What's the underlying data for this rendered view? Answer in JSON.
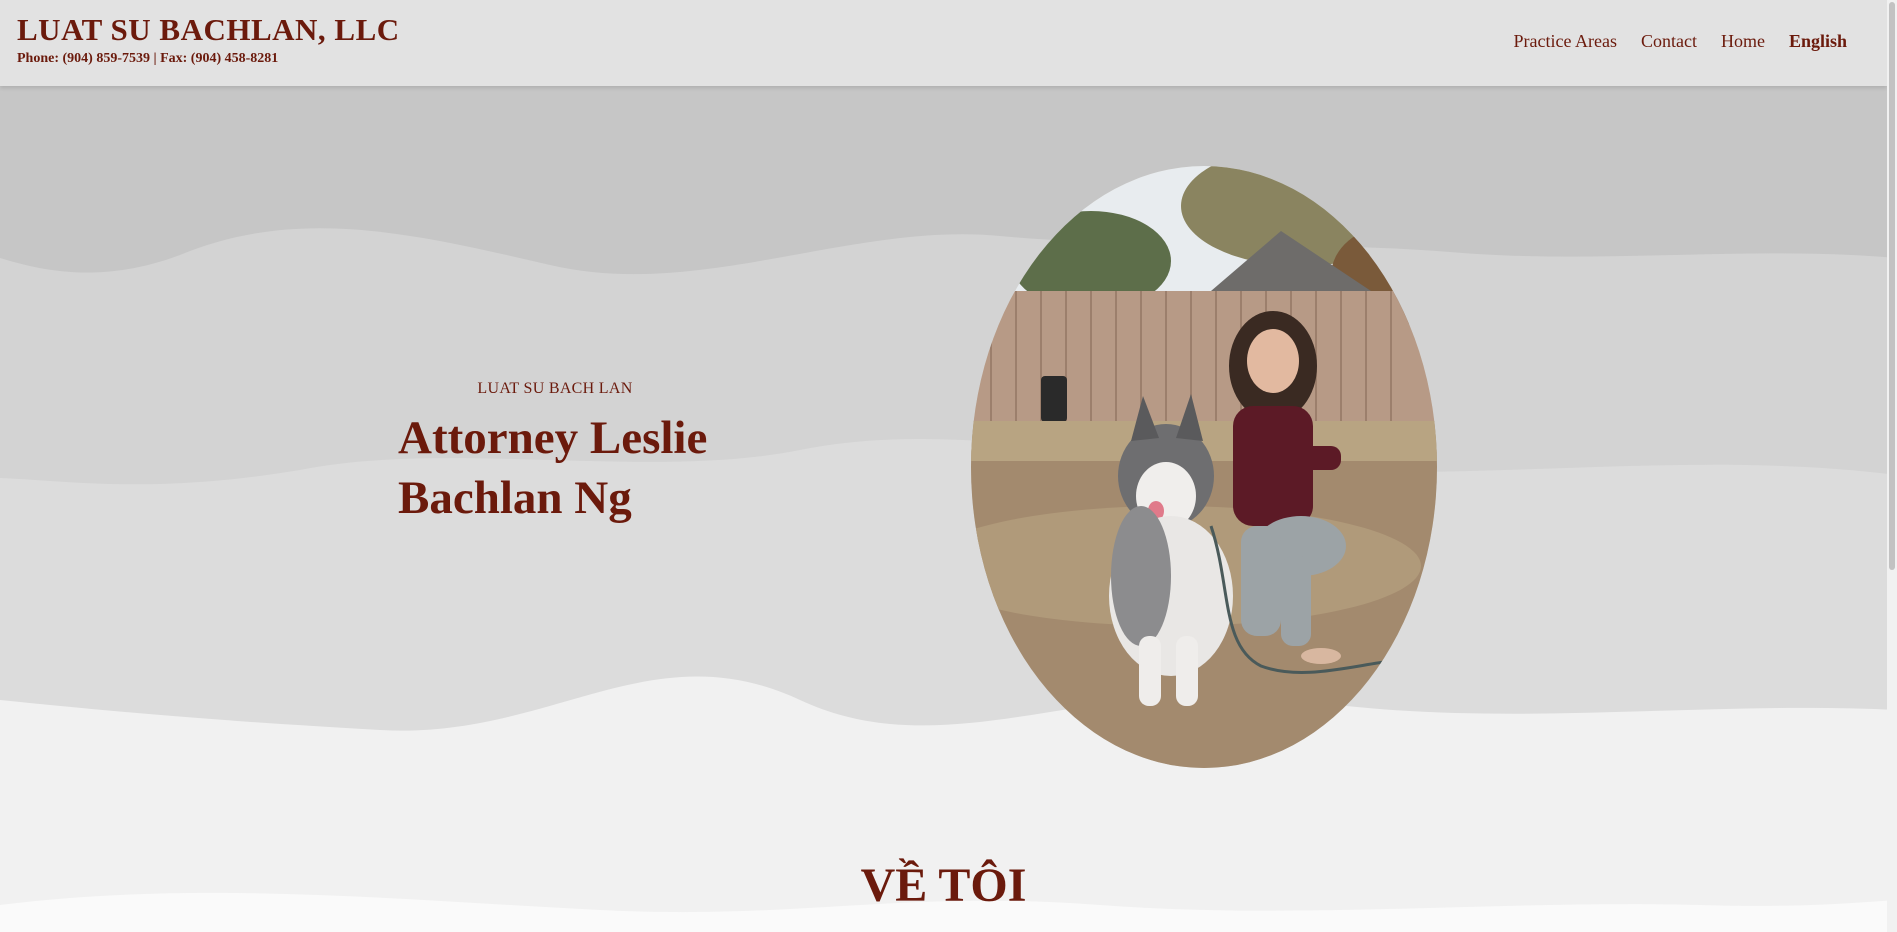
{
  "header": {
    "title": "LUAT SU BACHLAN, LLC",
    "contact": "Phone: (904) 859-7539 | Fax: (904) 458-8281",
    "nav": [
      {
        "label": "Practice Areas"
      },
      {
        "label": "Contact"
      },
      {
        "label": "Home"
      },
      {
        "label": "English"
      }
    ]
  },
  "hero": {
    "eyebrow": "LUAT SU BACH LAN",
    "heading": "Attorney Leslie Bachlan Ng",
    "portrait_icon": "portrait-photo-icon"
  },
  "about": {
    "title": "VỀ TÔI"
  },
  "colors": {
    "accent": "#6b1a0c",
    "header_bg": "#e2e2e2",
    "wave_dark": "#c6c6c6",
    "wave_mid": "#d3d3d3",
    "wave_light": "#dcdcdc",
    "page_bg": "#f1f1f1"
  }
}
